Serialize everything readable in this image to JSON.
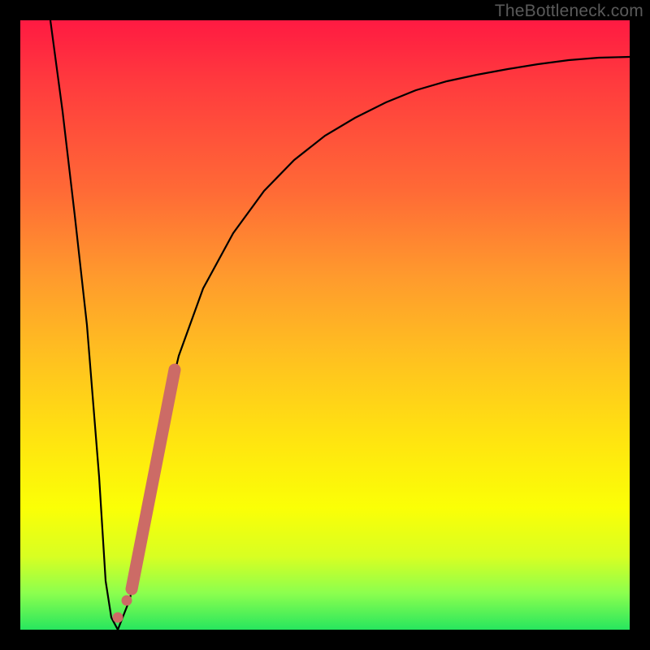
{
  "watermark": "TheBottleneck.com",
  "chart_data": {
    "type": "line",
    "title": "",
    "xlabel": "",
    "ylabel": "",
    "xlim": [
      0,
      100
    ],
    "ylim": [
      0,
      100
    ],
    "series": [
      {
        "name": "bottleneck-curve",
        "x": [
          5,
          7,
          9,
          11,
          13,
          14,
          15,
          16,
          18,
          20,
          23,
          26,
          30,
          35,
          40,
          45,
          50,
          55,
          60,
          65,
          70,
          75,
          80,
          85,
          90,
          95,
          100
        ],
        "y": [
          100,
          85,
          68,
          50,
          25,
          8,
          2,
          0,
          5,
          16,
          32,
          45,
          56,
          65,
          72,
          77,
          81,
          84,
          86.5,
          88.5,
          90,
          91,
          92,
          92.8,
          93.4,
          93.8,
          94
        ]
      }
    ],
    "highlight_band": {
      "name": "marker-band",
      "x_range": [
        17.5,
        25.5
      ],
      "y_range": [
        10,
        50
      ]
    },
    "highlight_dots": {
      "name": "marker-dots",
      "points": [
        {
          "x": 16.0,
          "y": 4
        },
        {
          "x": 17.3,
          "y": 10
        }
      ]
    }
  },
  "colors": {
    "curve": "#000000",
    "marker": "#cc6b66"
  }
}
